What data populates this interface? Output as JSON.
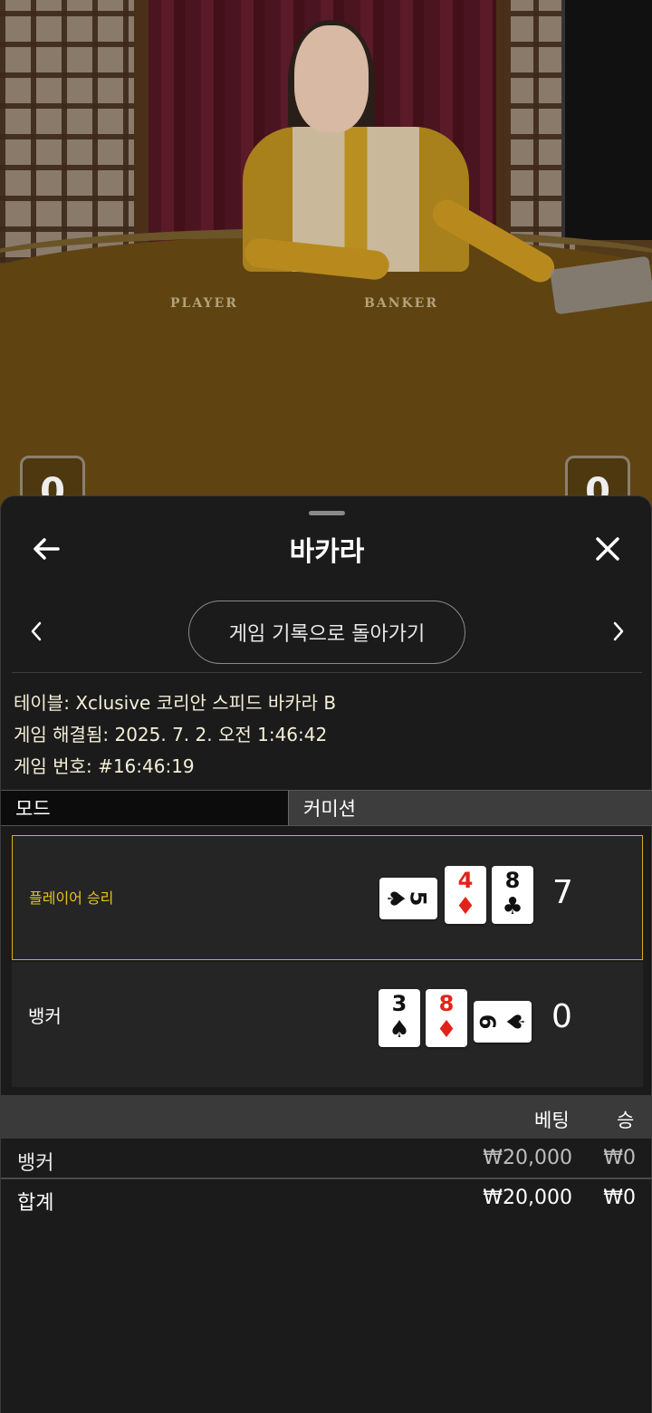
{
  "video": {
    "table_labels": {
      "player": "PLAYER",
      "banker": "BANKER"
    },
    "player_score": "0",
    "banker_score": "0"
  },
  "sheet": {
    "title": "바카라",
    "back_icon": "arrow-left-icon",
    "close_icon": "close-icon",
    "history_button": "게임 기록으로 돌아가기",
    "prev_icon": "chevron-left-icon",
    "next_icon": "chevron-right-icon"
  },
  "info": {
    "table_label": "테이블:",
    "table_value": "Xclusive 코리안 스피드 바카라 B",
    "resolved_label": "게임 해결됨:",
    "resolved_value": "2025. 7. 2. 오전 1:46:42",
    "number_label": "게임 번호:",
    "number_value": "#16:46:19"
  },
  "tabs": [
    {
      "label": "모드",
      "active": true
    },
    {
      "label": "커미션",
      "active": false
    }
  ],
  "hands": [
    {
      "label": "플레이어 승리",
      "winner": true,
      "label_color": "#e8c21c",
      "cards": [
        {
          "rank": "5",
          "suit": "♠",
          "color": "black",
          "orientation": "horizontal"
        },
        {
          "rank": "4",
          "suit": "♦",
          "color": "red",
          "orientation": "vertical"
        },
        {
          "rank": "8",
          "suit": "♣",
          "color": "black",
          "orientation": "vertical"
        }
      ],
      "score": "7"
    },
    {
      "label": "뱅커",
      "winner": false,
      "label_color": "#ffffff",
      "cards": [
        {
          "rank": "3",
          "suit": "♠",
          "color": "black",
          "orientation": "vertical"
        },
        {
          "rank": "8",
          "suit": "♦",
          "color": "red",
          "orientation": "vertical"
        },
        {
          "rank": "9",
          "suit": "♠",
          "color": "black",
          "orientation": "horizontal"
        }
      ],
      "score": "0"
    }
  ],
  "bets": {
    "headers": {
      "bet": "베팅",
      "win": "승"
    },
    "rows": [
      {
        "name": "뱅커",
        "bet": "₩20,000",
        "win": "₩0"
      }
    ],
    "total": {
      "name": "합계",
      "bet": "₩20,000",
      "win": "₩0"
    }
  },
  "colors": {
    "accent_gold": "#d4b21a",
    "sheet_bg": "#1b1b1b",
    "card_red": "#e2231a"
  }
}
